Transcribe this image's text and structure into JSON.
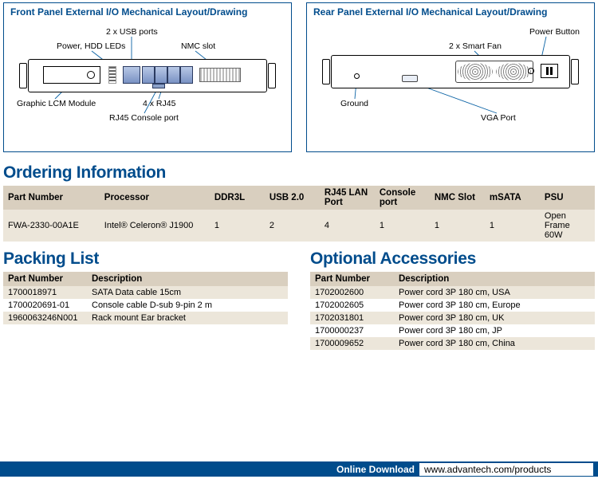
{
  "diagram_front": {
    "title": "Front Panel External I/O Mechanical Layout/Drawing",
    "callouts": {
      "usb": "2 x USB ports",
      "leds": "Power, HDD LEDs",
      "nmc": "NMC slot",
      "lcm": "Graphic LCM Module",
      "rj45": "4 x RJ45",
      "cons": "RJ45 Console port"
    }
  },
  "diagram_rear": {
    "title": "Rear Panel External I/O Mechanical Layout/Drawing",
    "callouts": {
      "pbtn": "Power Button",
      "fans": "2 x Smart Fan",
      "gnd": "Ground",
      "vga": "VGA Port"
    }
  },
  "ordering": {
    "heading": "Ordering Information",
    "headers": [
      "Part Number",
      "Processor",
      "DDR3L",
      "USB 2.0",
      "RJ45 LAN Port",
      "Console port",
      "NMC Slot",
      "mSATA",
      "PSU"
    ],
    "rows": [
      [
        "FWA-2330-00A1E",
        "Intel® Celeron® J1900",
        "1",
        "2",
        "4",
        "1",
        "1",
        "1",
        "Open Frame 60W"
      ]
    ]
  },
  "packing": {
    "heading": "Packing List",
    "headers": [
      "Part Number",
      "Description"
    ],
    "rows": [
      [
        "1700018971",
        "SATA Data cable 15cm"
      ],
      [
        "1700020691-01",
        "Console cable D-sub 9-pin 2 m"
      ],
      [
        "1960063246N001",
        "Rack mount Ear bracket"
      ]
    ]
  },
  "accessories": {
    "heading": "Optional Accessories",
    "headers": [
      "Part Number",
      "Description"
    ],
    "rows": [
      [
        "1702002600",
        "Power cord 3P 180 cm, USA"
      ],
      [
        "1702002605",
        "Power cord 3P 180 cm, Europe"
      ],
      [
        "1702031801",
        "Power cord 3P 180 cm, UK"
      ],
      [
        "1700000237",
        "Power cord 3P 180 cm, JP"
      ],
      [
        "1700009652",
        "Power cord 3P 180 cm, China"
      ]
    ]
  },
  "footer": {
    "label": "Online Download",
    "url": "www.advantech.com/products"
  }
}
